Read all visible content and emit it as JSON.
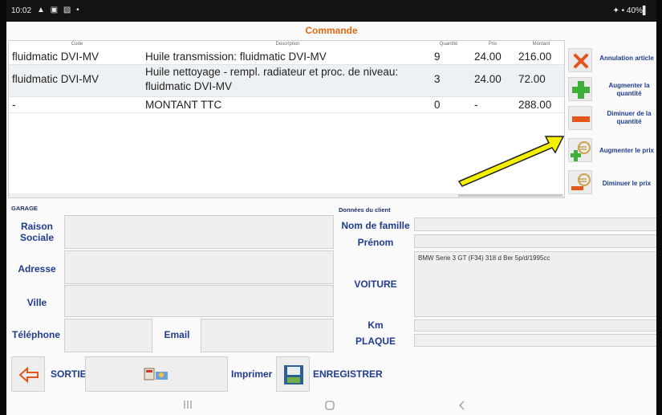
{
  "status_bar": {
    "time": "10:02",
    "notification_icons": "▲ ▣ ▨ •",
    "right": "✦ • 40%▌"
  },
  "title": "Commande",
  "table": {
    "headers": {
      "code": "Code",
      "description": "Description",
      "quantity": "Quantité",
      "price": "Prix",
      "amount": "Montant"
    },
    "rows": [
      {
        "code": "fluidmatic DVI-MV",
        "description": "Huile transmission: fluidmatic DVI-MV",
        "quantity": "9",
        "price": "24.00",
        "amount": "216.00"
      },
      {
        "code": "fluidmatic DVI-MV",
        "description": "Huile nettoyage - rempl. radiateur et proc. de niveau:",
        "description2": "fluidmatic DVI-MV",
        "quantity": "3",
        "price": "24.00",
        "amount": "72.00"
      },
      {
        "code": "-",
        "description": "MONTANT TTC",
        "quantity": "0",
        "price": "-",
        "amount": "288.00"
      }
    ]
  },
  "side_actions": {
    "cancel": "Annulation article",
    "increase_qty_1": "Augmenter la",
    "increase_qty_2": "quantité",
    "decrease_qty_1": "Diminuer de la",
    "decrease_qty_2": "quantité",
    "increase_price": "Augmenter le prix",
    "decrease_price": "Diminuer le prix"
  },
  "garage": {
    "section": "GARAGE",
    "company_1": "Raison",
    "company_2": "Sociale",
    "address": "Adresse",
    "city": "Ville",
    "phone": "Téléphone",
    "email": "Email"
  },
  "client": {
    "section": "Données du client",
    "last_name": "Nom de famille",
    "first_name": "Prénom",
    "car": "VOITURE",
    "car_value": "BMW Serie 3 GT (F34) 318 d Ber 5p/d/1995cc",
    "km": "Km",
    "plate": "PLAQUE"
  },
  "bottom": {
    "exit": "SORTIE",
    "print": "Imprimer",
    "save": "ENREGISTRER"
  },
  "colors": {
    "title": "#e06a12",
    "label": "#1f3c8f",
    "annotation_arrow": "#f5f000"
  }
}
